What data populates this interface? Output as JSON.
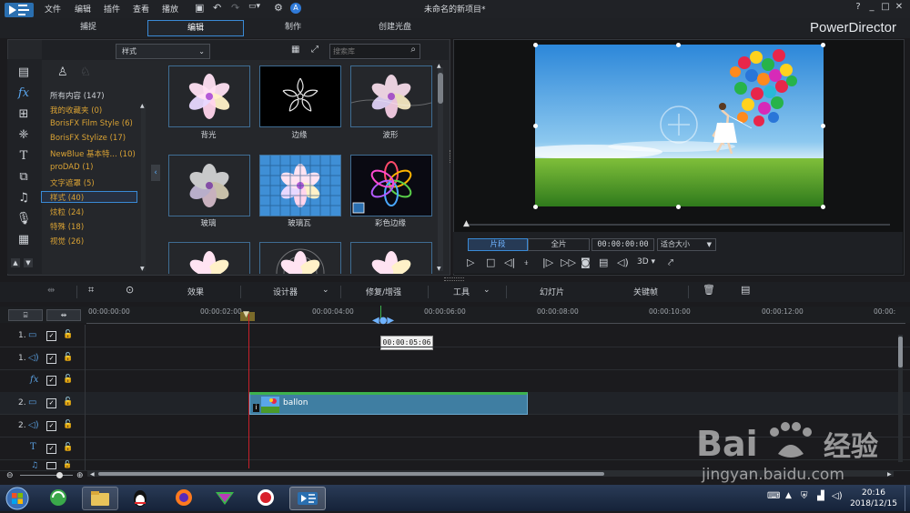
{
  "app": {
    "window_title": "未命名的新项目*",
    "brand": "PowerDirector",
    "menu": [
      "文件",
      "编辑",
      "插件",
      "查看",
      "播放"
    ],
    "window_buttons": [
      "?",
      "_",
      "□",
      "✕"
    ]
  },
  "tabs": [
    {
      "label": "捕捉",
      "active": false
    },
    {
      "label": "编辑",
      "active": true
    },
    {
      "label": "制作",
      "active": false
    },
    {
      "label": "创建光盘",
      "active": false
    }
  ],
  "library": {
    "style_dropdown": "样式",
    "search_placeholder": "搜索库",
    "categories": [
      "所有内容 (147)",
      "我的收藏夹 (0)",
      "BorisFX Film Style (6)",
      "BorisFX Stylize (17)",
      "NewBlue 基本特... (10)",
      "proDAD (1)",
      "文字遮罩 (5)",
      "样式 (40)",
      "炫粒 (24)",
      "特殊 (18)",
      "视觉 (26)"
    ],
    "selected_category_index": 7,
    "effects": [
      {
        "label": "背光"
      },
      {
        "label": "边缘"
      },
      {
        "label": "波形"
      },
      {
        "label": "玻璃"
      },
      {
        "label": "玻璃瓦"
      },
      {
        "label": "彩色边缘"
      }
    ]
  },
  "preview": {
    "mode_clip": "片段",
    "mode_full": "全片",
    "timecode": "00:00:00:00",
    "fit": "适合大小",
    "three_d": "3D"
  },
  "toolbar": {
    "effects": "效果",
    "designer": "设计器",
    "fix_enhance": "修复/增强",
    "tools": "工具",
    "slideshow": "幻灯片",
    "keyframe": "关键帧"
  },
  "timeline": {
    "ruler_labels": [
      "00:00:00:00",
      "00:00:02:00",
      "00:00:04:00",
      "00:00:06:00",
      "00:00:08:00",
      "00:00:10:00",
      "00:00:12:00",
      "00:00:"
    ],
    "tooltip": "00:00:05:06",
    "clip_name": "ballon",
    "tracks": [
      {
        "label": "1."
      },
      {
        "label": "1."
      },
      {
        "label": ""
      },
      {
        "label": "2."
      },
      {
        "label": "2."
      },
      {
        "label": ""
      },
      {
        "label": ""
      }
    ]
  },
  "taskbar": {
    "time": "20:16",
    "date": "2018/12/15"
  }
}
